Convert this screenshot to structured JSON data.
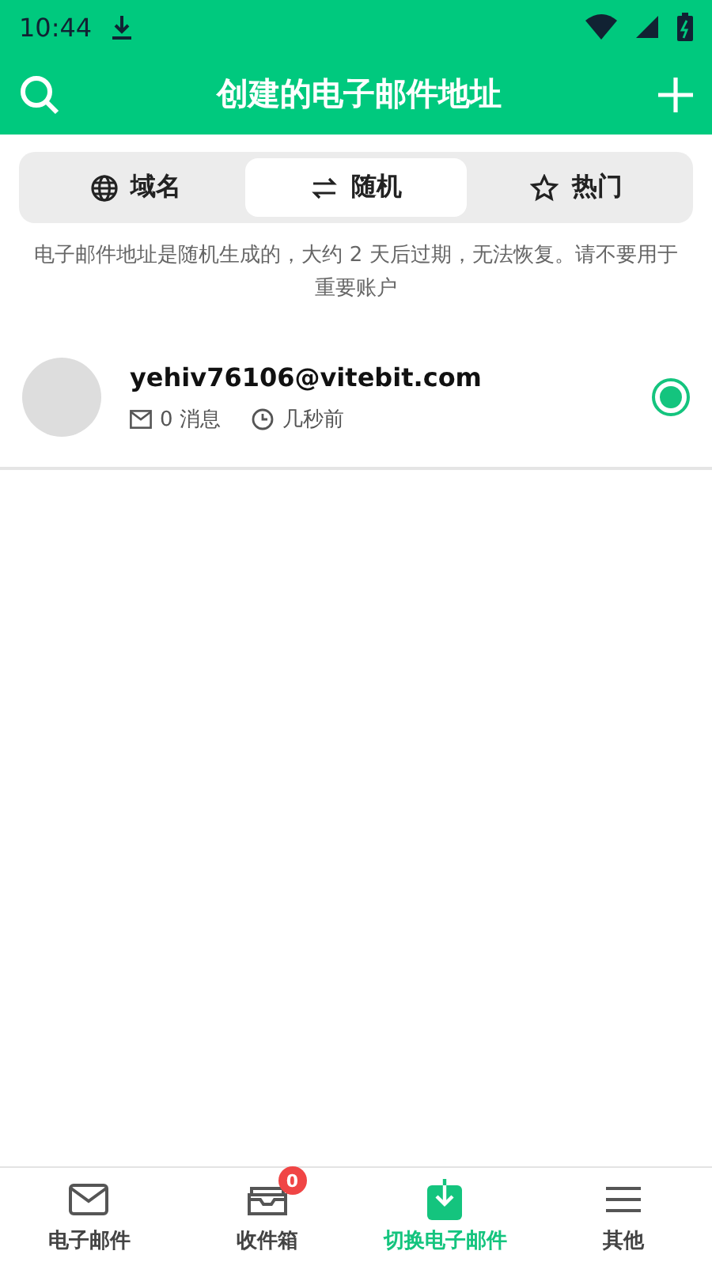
{
  "status_bar": {
    "time": "10:44"
  },
  "app_bar": {
    "title": "创建的电子邮件地址"
  },
  "tabs": [
    {
      "kind": "globe",
      "label": "域名",
      "selected": false
    },
    {
      "kind": "swap",
      "label": "随机",
      "selected": true
    },
    {
      "kind": "star",
      "label": "热门",
      "selected": false
    }
  ],
  "notice": "电子邮件地址是随机生成的，大约 2 天后过期，无法恢复。请不要用于重要账户",
  "addresses": [
    {
      "email": "yehiv76106@vitebit.com",
      "messages": "0 消息",
      "time": "几秒前",
      "selected": true
    }
  ],
  "bottom_nav": [
    {
      "kind": "mail",
      "label": "电子邮件",
      "selected": false
    },
    {
      "kind": "inbox",
      "label": "收件箱",
      "badge": "0",
      "selected": false
    },
    {
      "kind": "switch",
      "label": "切换电子邮件",
      "selected": true
    },
    {
      "kind": "menu",
      "label": "其他",
      "selected": false
    }
  ]
}
